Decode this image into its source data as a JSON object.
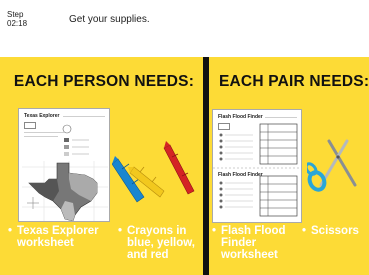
{
  "header": {
    "step_label": "Step",
    "step_number": "02:18",
    "title": "Get your supplies."
  },
  "left_panel": {
    "title": "EACH PERSON NEEDS:",
    "worksheet_title": "Texas Explorer",
    "items": [
      {
        "label": "Texas Explorer worksheet"
      },
      {
        "label": "Crayons in blue, yellow, and red"
      }
    ]
  },
  "right_panel": {
    "title": "EACH PAIR NEEDS:",
    "worksheet_title": "Flash Flood Finder",
    "items": [
      {
        "label": "Flash Flood Finder worksheet"
      },
      {
        "label": "Scissors"
      }
    ]
  },
  "colors": {
    "panel_yellow": "#fddb36",
    "divider_black": "#111111",
    "crayon_blue": "#1a86d0",
    "crayon_yellow": "#f2c81e",
    "crayon_red": "#d42424",
    "scissors_blue": "#2aa6d6"
  },
  "bullet_glyph": "•"
}
